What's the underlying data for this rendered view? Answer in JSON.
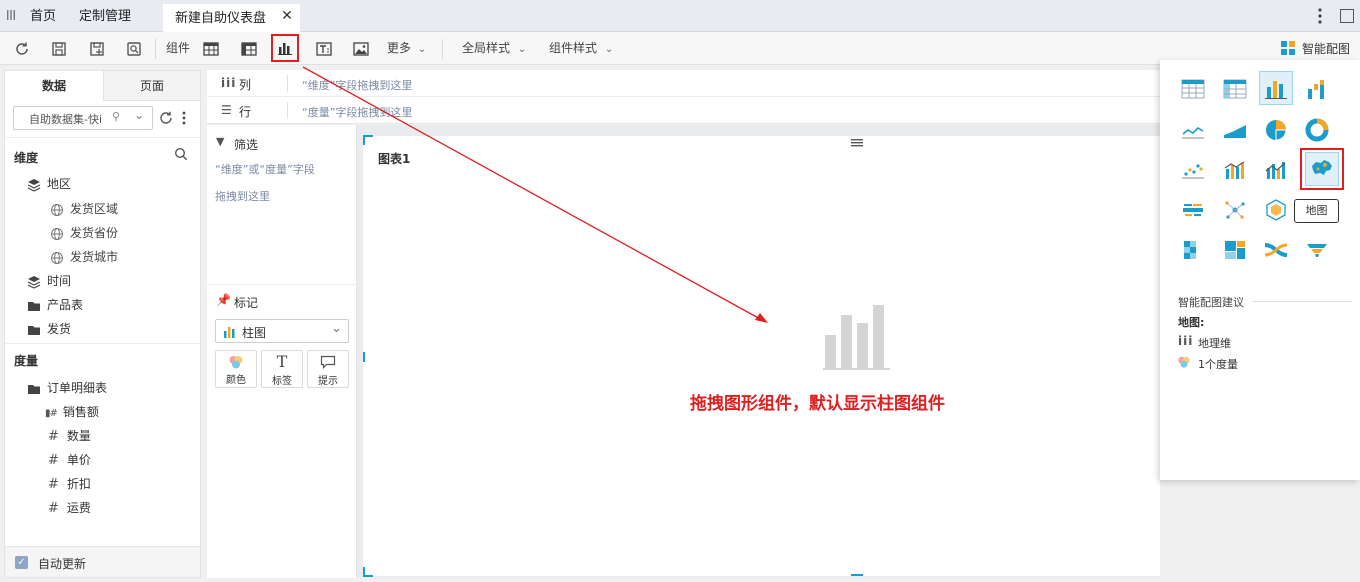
{
  "tabs": {
    "home": "首页",
    "custom": "定制管理",
    "active": "新建自助仪表盘"
  },
  "toolbar": {
    "component_label": "组件",
    "more_label": "更多",
    "global_style_label": "全局样式",
    "component_style_label": "组件样式",
    "smart_chart_label": "智能配图"
  },
  "left_panel": {
    "tab_data": "数据",
    "tab_page": "页面",
    "dataset_value": "自助数据集-快i",
    "dimension_title": "维度",
    "dimensions": {
      "region": "地区",
      "ship_area": "发货区域",
      "ship_province": "发货省份",
      "ship_city": "发货城市",
      "time": "时间",
      "product_table": "产品表",
      "shipping": "发货"
    },
    "measure_title": "度量",
    "measures": {
      "order_detail": "订单明细表",
      "sales": "销售额",
      "quantity": "数量",
      "unit_price": "单价",
      "discount": "折扣",
      "freight": "运费"
    },
    "auto_update": "自动更新"
  },
  "rails": {
    "col_label": "列",
    "col_hint": "“维度”字段拖拽到这里",
    "row_label": "行",
    "row_hint": "“度量”字段拖拽到这里"
  },
  "mid_panel": {
    "filter_label": "筛选",
    "filter_hint_1": "“维度”或“度量”字段",
    "filter_hint_2": "拖拽到这里",
    "marks_label": "标记",
    "mark_type": "柱图",
    "mark_color": "颜色",
    "mark_label": "标签",
    "mark_tooltip": "提示",
    "mark_label_glyph": "T"
  },
  "canvas": {
    "chart_title": "图表1",
    "annotation": "拖拽图形组件，默认显示柱图组件"
  },
  "right_panel": {
    "tooltip_map": "地图",
    "suggest_title": "智能配图建议",
    "suggest_type": "地图:",
    "suggest_dim": "地理维",
    "suggest_measure": "1个度量"
  },
  "colors": {
    "accent_blue": "#1a9ccc",
    "annotation_red": "#e02020",
    "hint_gray": "#7a8aa4"
  }
}
